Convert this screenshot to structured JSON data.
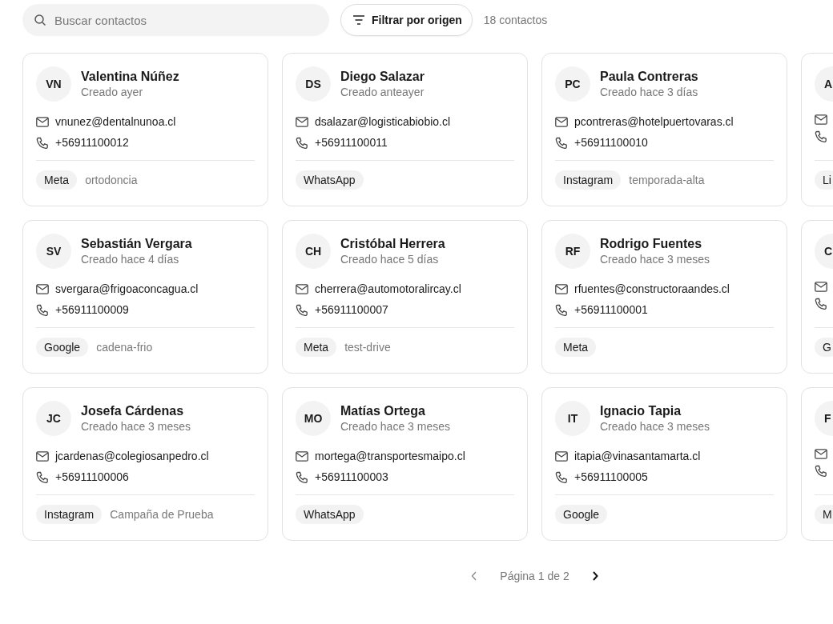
{
  "search": {
    "placeholder": "Buscar contactos"
  },
  "filter_button": {
    "label": "Filtrar por origen"
  },
  "count": "18 contactos",
  "contacts": [
    {
      "initials": "VN",
      "name": "Valentina Núñez",
      "created": "Creado ayer",
      "email": "vnunez@dentalnunoa.cl",
      "phone": "+56911100012",
      "tags": [
        {
          "kind": "source",
          "text": "Meta"
        },
        {
          "kind": "label",
          "text": "ortodoncia"
        }
      ]
    },
    {
      "initials": "DS",
      "name": "Diego Salazar",
      "created": "Creado anteayer",
      "email": "dsalazar@logisticabiobio.cl",
      "phone": "+56911100011",
      "tags": [
        {
          "kind": "source",
          "text": "WhatsApp"
        }
      ]
    },
    {
      "initials": "PC",
      "name": "Paula Contreras",
      "created": "Creado hace 3 días",
      "email": "pcontreras@hotelpuertovaras.cl",
      "phone": "+56911100010",
      "tags": [
        {
          "kind": "source",
          "text": "Instagram"
        },
        {
          "kind": "label",
          "text": "temporada-alta"
        }
      ]
    },
    {
      "initials": "A",
      "tags": [
        {
          "kind": "source",
          "text": "Li"
        }
      ]
    },
    {
      "initials": "SV",
      "name": "Sebastián Vergara",
      "created": "Creado hace 4 días",
      "email": "svergara@frigoaconcagua.cl",
      "phone": "+56911100009",
      "tags": [
        {
          "kind": "source",
          "text": "Google"
        },
        {
          "kind": "label",
          "text": "cadena-frio"
        }
      ]
    },
    {
      "initials": "CH",
      "name": "Cristóbal Herrera",
      "created": "Creado hace 5 días",
      "email": "cherrera@automotoralircay.cl",
      "phone": "+56911100007",
      "tags": [
        {
          "kind": "source",
          "text": "Meta"
        },
        {
          "kind": "label",
          "text": "test-drive"
        }
      ]
    },
    {
      "initials": "RF",
      "name": "Rodrigo Fuentes",
      "created": "Creado hace 3 meses",
      "email": "rfuentes@constructoraandes.cl",
      "phone": "+56911100001",
      "tags": [
        {
          "kind": "source",
          "text": "Meta"
        }
      ]
    },
    {
      "initials": "C",
      "tags": [
        {
          "kind": "source",
          "text": "G"
        }
      ]
    },
    {
      "initials": "JC",
      "name": "Josefa Cárdenas",
      "created": "Creado hace 3 meses",
      "email": "jcardenas@colegiosanpedro.cl",
      "phone": "+56911100006",
      "tags": [
        {
          "kind": "source",
          "text": "Instagram"
        },
        {
          "kind": "label",
          "text": "Campaña de Prueba"
        }
      ]
    },
    {
      "initials": "MO",
      "name": "Matías Ortega",
      "created": "Creado hace 3 meses",
      "email": "mortega@transportesmaipo.cl",
      "phone": "+56911100003",
      "tags": [
        {
          "kind": "source",
          "text": "WhatsApp"
        }
      ]
    },
    {
      "initials": "IT",
      "name": "Ignacio Tapia",
      "created": "Creado hace 3 meses",
      "email": "itapia@vinasantamarta.cl",
      "phone": "+56911100005",
      "tags": [
        {
          "kind": "source",
          "text": "Google"
        }
      ]
    },
    {
      "initials": "F",
      "tags": [
        {
          "kind": "source",
          "text": "M"
        }
      ]
    }
  ],
  "pagination": {
    "label": "Página 1 de 2",
    "prev_disabled": true,
    "next_disabled": false
  }
}
